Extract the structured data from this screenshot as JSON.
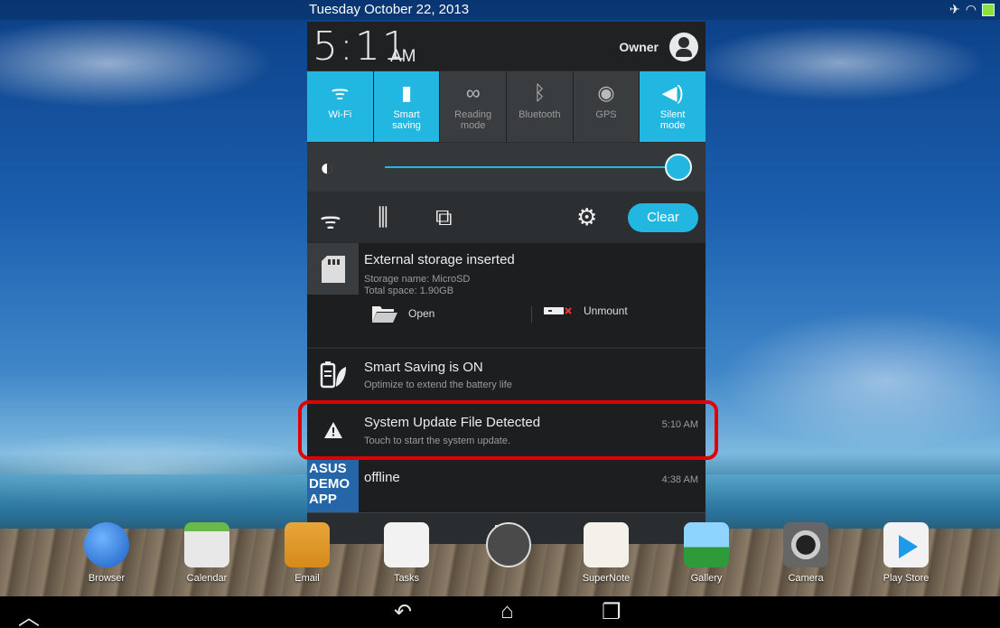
{
  "status_bar": {
    "date": "Tuesday October 22, 2013"
  },
  "header": {
    "time": "5:11",
    "ampm": "AM",
    "user": "Owner"
  },
  "quick_settings": [
    {
      "label": "Wi-Fi",
      "icon": "wifi-icon",
      "active": true
    },
    {
      "label": "Smart saving",
      "icon": "battery-leaf-icon",
      "active": true
    },
    {
      "label": "Reading mode",
      "icon": "glasses-icon",
      "active": false
    },
    {
      "label": "Bluetooth",
      "icon": "bluetooth-icon",
      "active": false
    },
    {
      "label": "GPS",
      "icon": "gps-icon",
      "active": false
    },
    {
      "label": "Silent mode",
      "icon": "speaker-icon",
      "active": true
    }
  ],
  "brightness": {
    "level": 0.98
  },
  "tools": {
    "clear_label": "Clear"
  },
  "notifications": {
    "storage": {
      "title": "External storage inserted",
      "line1": "Storage name: MicroSD",
      "line2": "Total space: 1.90GB",
      "open_label": "Open",
      "unmount_label": "Unmount"
    },
    "smart_saving": {
      "title": "Smart Saving is ON",
      "text": "Optimize to extend the battery life"
    },
    "system_update": {
      "title": "System Update File Detected",
      "text": "Touch to start the system update.",
      "time": "5:10 AM"
    },
    "offline": {
      "title": "offline",
      "time": "4:38 AM",
      "icon_text": "ASUS DEMO APP"
    }
  },
  "dock": [
    {
      "label": "Browser"
    },
    {
      "label": "Calendar"
    },
    {
      "label": "Email"
    },
    {
      "label": "Tasks"
    },
    {
      "label": "SuperNote"
    },
    {
      "label": "Gallery"
    },
    {
      "label": "Camera"
    },
    {
      "label": "Play Store"
    }
  ],
  "colors": {
    "accent": "#21b7e0",
    "highlight": "#e00000",
    "panel": "#2a2d30"
  }
}
